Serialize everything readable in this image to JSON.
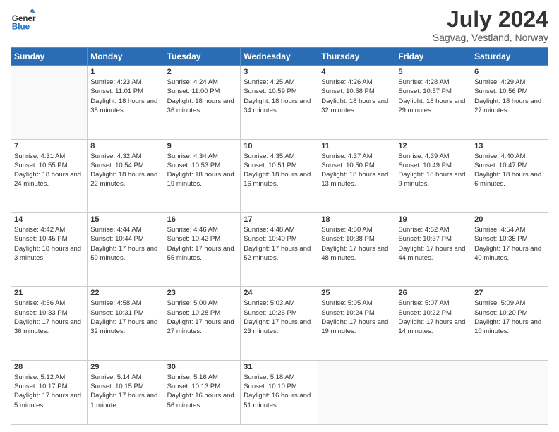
{
  "logo": {
    "line1": "General",
    "line2": "Blue"
  },
  "title": "July 2024",
  "subtitle": "Sagvag, Vestland, Norway",
  "days": [
    "Sunday",
    "Monday",
    "Tuesday",
    "Wednesday",
    "Thursday",
    "Friday",
    "Saturday"
  ],
  "weeks": [
    [
      {
        "num": "",
        "sunrise": "",
        "sunset": "",
        "daylight": ""
      },
      {
        "num": "1",
        "sunrise": "Sunrise: 4:23 AM",
        "sunset": "Sunset: 11:01 PM",
        "daylight": "Daylight: 18 hours and 38 minutes."
      },
      {
        "num": "2",
        "sunrise": "Sunrise: 4:24 AM",
        "sunset": "Sunset: 11:00 PM",
        "daylight": "Daylight: 18 hours and 36 minutes."
      },
      {
        "num": "3",
        "sunrise": "Sunrise: 4:25 AM",
        "sunset": "Sunset: 10:59 PM",
        "daylight": "Daylight: 18 hours and 34 minutes."
      },
      {
        "num": "4",
        "sunrise": "Sunrise: 4:26 AM",
        "sunset": "Sunset: 10:58 PM",
        "daylight": "Daylight: 18 hours and 32 minutes."
      },
      {
        "num": "5",
        "sunrise": "Sunrise: 4:28 AM",
        "sunset": "Sunset: 10:57 PM",
        "daylight": "Daylight: 18 hours and 29 minutes."
      },
      {
        "num": "6",
        "sunrise": "Sunrise: 4:29 AM",
        "sunset": "Sunset: 10:56 PM",
        "daylight": "Daylight: 18 hours and 27 minutes."
      }
    ],
    [
      {
        "num": "7",
        "sunrise": "Sunrise: 4:31 AM",
        "sunset": "Sunset: 10:55 PM",
        "daylight": "Daylight: 18 hours and 24 minutes."
      },
      {
        "num": "8",
        "sunrise": "Sunrise: 4:32 AM",
        "sunset": "Sunset: 10:54 PM",
        "daylight": "Daylight: 18 hours and 22 minutes."
      },
      {
        "num": "9",
        "sunrise": "Sunrise: 4:34 AM",
        "sunset": "Sunset: 10:53 PM",
        "daylight": "Daylight: 18 hours and 19 minutes."
      },
      {
        "num": "10",
        "sunrise": "Sunrise: 4:35 AM",
        "sunset": "Sunset: 10:51 PM",
        "daylight": "Daylight: 18 hours and 16 minutes."
      },
      {
        "num": "11",
        "sunrise": "Sunrise: 4:37 AM",
        "sunset": "Sunset: 10:50 PM",
        "daylight": "Daylight: 18 hours and 13 minutes."
      },
      {
        "num": "12",
        "sunrise": "Sunrise: 4:39 AM",
        "sunset": "Sunset: 10:49 PM",
        "daylight": "Daylight: 18 hours and 9 minutes."
      },
      {
        "num": "13",
        "sunrise": "Sunrise: 4:40 AM",
        "sunset": "Sunset: 10:47 PM",
        "daylight": "Daylight: 18 hours and 6 minutes."
      }
    ],
    [
      {
        "num": "14",
        "sunrise": "Sunrise: 4:42 AM",
        "sunset": "Sunset: 10:45 PM",
        "daylight": "Daylight: 18 hours and 3 minutes."
      },
      {
        "num": "15",
        "sunrise": "Sunrise: 4:44 AM",
        "sunset": "Sunset: 10:44 PM",
        "daylight": "Daylight: 17 hours and 59 minutes."
      },
      {
        "num": "16",
        "sunrise": "Sunrise: 4:46 AM",
        "sunset": "Sunset: 10:42 PM",
        "daylight": "Daylight: 17 hours and 55 minutes."
      },
      {
        "num": "17",
        "sunrise": "Sunrise: 4:48 AM",
        "sunset": "Sunset: 10:40 PM",
        "daylight": "Daylight: 17 hours and 52 minutes."
      },
      {
        "num": "18",
        "sunrise": "Sunrise: 4:50 AM",
        "sunset": "Sunset: 10:38 PM",
        "daylight": "Daylight: 17 hours and 48 minutes."
      },
      {
        "num": "19",
        "sunrise": "Sunrise: 4:52 AM",
        "sunset": "Sunset: 10:37 PM",
        "daylight": "Daylight: 17 hours and 44 minutes."
      },
      {
        "num": "20",
        "sunrise": "Sunrise: 4:54 AM",
        "sunset": "Sunset: 10:35 PM",
        "daylight": "Daylight: 17 hours and 40 minutes."
      }
    ],
    [
      {
        "num": "21",
        "sunrise": "Sunrise: 4:56 AM",
        "sunset": "Sunset: 10:33 PM",
        "daylight": "Daylight: 17 hours and 36 minutes."
      },
      {
        "num": "22",
        "sunrise": "Sunrise: 4:58 AM",
        "sunset": "Sunset: 10:31 PM",
        "daylight": "Daylight: 17 hours and 32 minutes."
      },
      {
        "num": "23",
        "sunrise": "Sunrise: 5:00 AM",
        "sunset": "Sunset: 10:28 PM",
        "daylight": "Daylight: 17 hours and 27 minutes."
      },
      {
        "num": "24",
        "sunrise": "Sunrise: 5:03 AM",
        "sunset": "Sunset: 10:26 PM",
        "daylight": "Daylight: 17 hours and 23 minutes."
      },
      {
        "num": "25",
        "sunrise": "Sunrise: 5:05 AM",
        "sunset": "Sunset: 10:24 PM",
        "daylight": "Daylight: 17 hours and 19 minutes."
      },
      {
        "num": "26",
        "sunrise": "Sunrise: 5:07 AM",
        "sunset": "Sunset: 10:22 PM",
        "daylight": "Daylight: 17 hours and 14 minutes."
      },
      {
        "num": "27",
        "sunrise": "Sunrise: 5:09 AM",
        "sunset": "Sunset: 10:20 PM",
        "daylight": "Daylight: 17 hours and 10 minutes."
      }
    ],
    [
      {
        "num": "28",
        "sunrise": "Sunrise: 5:12 AM",
        "sunset": "Sunset: 10:17 PM",
        "daylight": "Daylight: 17 hours and 5 minutes."
      },
      {
        "num": "29",
        "sunrise": "Sunrise: 5:14 AM",
        "sunset": "Sunset: 10:15 PM",
        "daylight": "Daylight: 17 hours and 1 minute."
      },
      {
        "num": "30",
        "sunrise": "Sunrise: 5:16 AM",
        "sunset": "Sunset: 10:13 PM",
        "daylight": "Daylight: 16 hours and 56 minutes."
      },
      {
        "num": "31",
        "sunrise": "Sunrise: 5:18 AM",
        "sunset": "Sunset: 10:10 PM",
        "daylight": "Daylight: 16 hours and 51 minutes."
      },
      {
        "num": "",
        "sunrise": "",
        "sunset": "",
        "daylight": ""
      },
      {
        "num": "",
        "sunrise": "",
        "sunset": "",
        "daylight": ""
      },
      {
        "num": "",
        "sunrise": "",
        "sunset": "",
        "daylight": ""
      }
    ]
  ]
}
